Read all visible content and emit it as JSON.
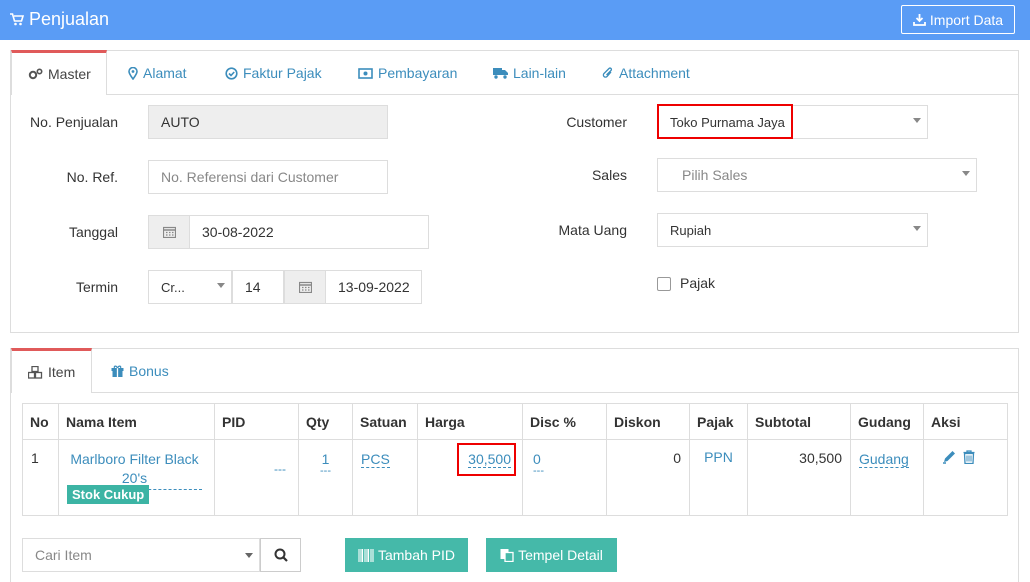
{
  "header": {
    "title": "Penjualan",
    "import_label": "Import Data"
  },
  "master_tabs": [
    {
      "label": "Master",
      "icon": "gears-icon"
    },
    {
      "label": "Alamat",
      "icon": "map-marker-icon"
    },
    {
      "label": "Faktur Pajak",
      "icon": "check-circle-icon"
    },
    {
      "label": "Pembayaran",
      "icon": "money-icon"
    },
    {
      "label": "Lain-lain",
      "icon": "truck-icon"
    },
    {
      "label": "Attachment",
      "icon": "paperclip-icon"
    }
  ],
  "form": {
    "no_penjualan_label": "No. Penjualan",
    "no_penjualan_value": "AUTO",
    "no_ref_label": "No. Ref.",
    "no_ref_placeholder": "No. Referensi dari Customer",
    "tanggal_label": "Tanggal",
    "tanggal_value": "30-08-2022",
    "termin_label": "Termin",
    "termin_type": "Cr...",
    "termin_days": "14",
    "termin_date": "13-09-2022",
    "customer_label": "Customer",
    "customer_value": "Toko Purnama Jaya",
    "sales_label": "Sales",
    "sales_placeholder": "Pilih Sales",
    "mata_uang_label": "Mata Uang",
    "mata_uang_value": "Rupiah",
    "pajak_label": "Pajak"
  },
  "item_tabs": [
    {
      "label": "Item",
      "icon": "cubes-icon"
    },
    {
      "label": "Bonus",
      "icon": "gift-icon"
    }
  ],
  "table": {
    "headers": [
      "No",
      "Nama Item",
      "PID",
      "Qty",
      "Satuan",
      "Harga",
      "Disc %",
      "Diskon",
      "Pajak",
      "Subtotal",
      "Gudang",
      "Aksi"
    ],
    "row": {
      "no": "1",
      "nama_item": "Marlboro Filter Black 20's",
      "stok": "Stok Cukup",
      "pid": "---",
      "qty": "1",
      "qty_sub": "---",
      "satuan": "PCS",
      "harga": "30,500",
      "disc": "0",
      "disc_sub": "---",
      "diskon": "0",
      "pajak": "PPN",
      "subtotal": "30,500",
      "gudang": "Gudang"
    }
  },
  "bottom": {
    "cari_placeholder": "Cari Item",
    "tambah_pid_label": "Tambah PID",
    "tempel_detail_label": "Tempel Detail"
  }
}
